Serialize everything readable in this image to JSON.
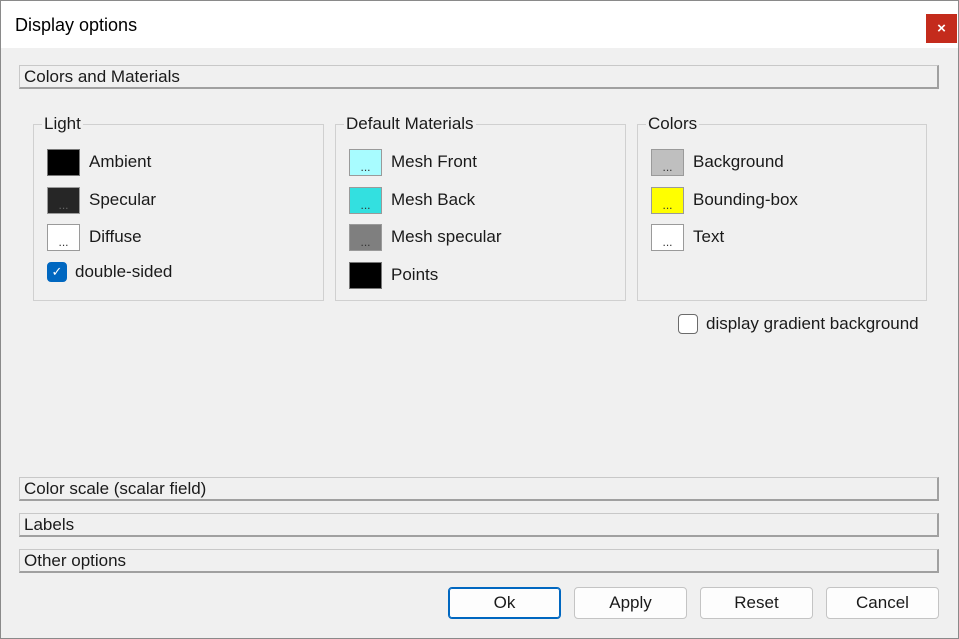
{
  "window": {
    "title": "Display options",
    "close_label": "×"
  },
  "sections": {
    "colors_materials": "Colors and Materials",
    "color_scale": "Color scale (scalar field)",
    "labels": "Labels",
    "other_options": "Other options"
  },
  "light": {
    "label": "Light",
    "items": [
      {
        "label": "Ambient",
        "color": "#000000",
        "swatch_text": ""
      },
      {
        "label": "Specular",
        "color": "#262626",
        "swatch_text": "..."
      },
      {
        "label": "Diffuse",
        "color": "#ffffff",
        "swatch_text": "..."
      }
    ],
    "double_sided": {
      "label": "double-sided",
      "checked": true,
      "mark": "✓"
    }
  },
  "materials": {
    "label": "Default Materials",
    "items": [
      {
        "label": "Mesh Front",
        "color": "#a8fcff",
        "swatch_text": "..."
      },
      {
        "label": "Mesh Back",
        "color": "#33e0e0",
        "swatch_text": "..."
      },
      {
        "label": "Mesh specular",
        "color": "#7f7f7f",
        "swatch_text": "..."
      },
      {
        "label": "Points",
        "color": "#000000",
        "swatch_text": ""
      }
    ]
  },
  "colors": {
    "label": "Colors",
    "items": [
      {
        "label": "Background",
        "color": "#bfbfbf",
        "swatch_text": "..."
      },
      {
        "label": "Bounding-box",
        "color": "#ffff00",
        "swatch_text": "..."
      },
      {
        "label": "Text",
        "color": "#ffffff",
        "swatch_text": "..."
      }
    ]
  },
  "gradient": {
    "label": "display gradient background",
    "checked": false
  },
  "buttons": {
    "ok": "Ok",
    "apply": "Apply",
    "reset": "Reset",
    "cancel": "Cancel"
  }
}
